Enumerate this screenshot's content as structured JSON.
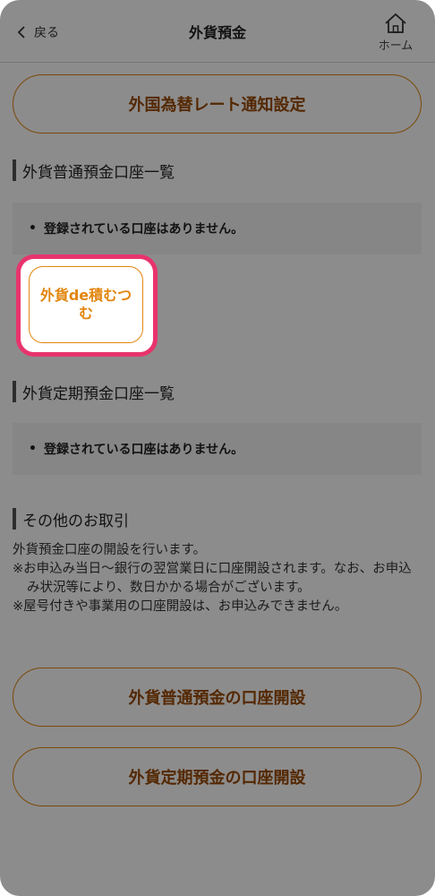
{
  "header": {
    "back_label": "戻る",
    "title": "外貨預金",
    "home_label": "ホーム"
  },
  "buttons": {
    "rate_notice": "外国為替レート通知設定",
    "tsumitate": "外貨de積むつむ",
    "open_ordinary": "外貨普通預金の口座開設",
    "open_time": "外貨定期預金の口座開設"
  },
  "sections": {
    "ordinary_title": "外貨普通預金口座一覧",
    "ordinary_empty": "登録されている口座はありません。",
    "time_title": "外貨定期預金口座一覧",
    "time_empty": "登録されている口座はありません。",
    "other_title": "その他のお取引"
  },
  "notes": {
    "line1": "外貨預金口座の開設を行います。",
    "line2": "※お申込み当日〜銀行の翌営業日に口座開設されます。なお、お申込み状況等により、数日かかる場合がございます。",
    "line3": "※屋号付きや事業用の口座開設は、お申込みできません。"
  },
  "colors": {
    "accent": "#e2850f",
    "highlight": "#e8346d",
    "dim_overlay": "rgba(0,0,0,0.45)"
  },
  "icons": {
    "back": "chevron-left-icon",
    "home": "home-icon"
  }
}
